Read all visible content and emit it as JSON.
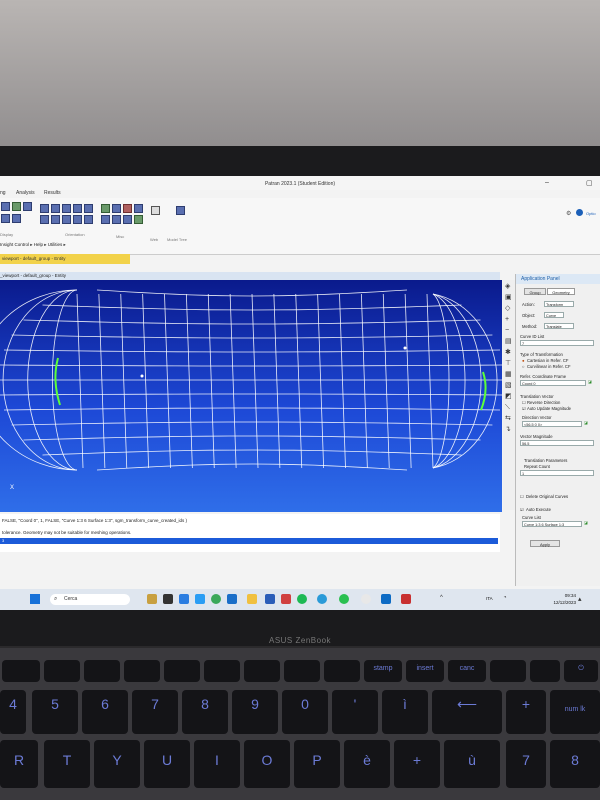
{
  "window": {
    "title": "Patran 2023.1 (Student Edition)",
    "controls": {
      "minimize": "–",
      "restore": "▢"
    }
  },
  "menu": {
    "items": [
      "ng",
      "Analysis",
      "Results"
    ]
  },
  "ribbon": {
    "group_labels": [
      "Display",
      "Orientation",
      "Misc",
      "Web",
      "Model Tree"
    ],
    "help_label": "Optio"
  },
  "breadcrumb": "Insight Control ▸ Help ▸ Utilities ▸",
  "document_tab": "viewport - default_group - Entity",
  "viewport_title": "_viewport - default_group - Entity",
  "axis_label": "X",
  "command_log": {
    "line1": "FALSE, \"Coord 0\", 1, FALSE, \"Curve 1:3 6 Surface 1:3\", sgm_transform_curve_created_ids )",
    "line2": "tolerance. Geometry may not be suitable for meshing operations.",
    "line3": "3"
  },
  "app_panel": {
    "title": "Application Panel",
    "tabs": [
      "Group",
      "Geometry"
    ],
    "action_label": "Action:",
    "action_value": "Transform",
    "object_label": "Object:",
    "object_value": "Curve",
    "method_label": "Method:",
    "method_value": "Translate",
    "curve_id_label": "Curve ID List",
    "curve_id_value": "7",
    "type_label": "Type of Transformation",
    "type_option1": "Cartesian in Refer. CF",
    "type_option2": "Curvilinear in Refer. CF",
    "refer_label": "Refer. Coordinate Frame",
    "refer_value": "Coord 0",
    "translation_label": "Translation Vector",
    "reverse_label": "Reverse Direction",
    "auto_update_label": "Auto Update Magnitude",
    "direction_label": "Direction Vector",
    "direction_value": "<56.5 0 0>",
    "magnitude_label": "Vector Magnitude",
    "magnitude_value": "56.5",
    "params_label": "Translation Parameters",
    "repeat_label": "Repeat Count",
    "repeat_value": "1",
    "delete_label": "Delete Original Curves",
    "auto_execute_label": "Auto Execute",
    "curve_list_label": "Curve List",
    "curve_list_value": "Curve 1:3 6 Surface 1:3",
    "apply_label": "Apply"
  },
  "taskbar": {
    "search_placeholder": "Cerca",
    "language": "ITA",
    "time": "09:34",
    "date": "12/12/2023"
  },
  "laptop_brand": "ASUS ZenBook",
  "keyboard": {
    "fn_row": [
      "",
      "",
      "",
      "",
      "",
      "",
      "",
      "",
      "",
      "",
      "",
      "stamp",
      "insert",
      "canc",
      "",
      "",
      ""
    ],
    "num_row": [
      "4",
      "5",
      "6",
      "7",
      "8",
      "9",
      "0",
      "'",
      "ì",
      "",
      "",
      "num lk"
    ],
    "letter_row": [
      "R",
      "T",
      "Y",
      "U",
      "I",
      "O",
      "P",
      "è",
      "+",
      "ù",
      "7",
      "8"
    ]
  },
  "colors": {
    "viewport_top": "#0a1a8c",
    "viewport_bottom": "#2f6ee9",
    "mesh": "#ffffff",
    "highlight": "#5cff3a",
    "tab_highlight": "#f2d24a"
  }
}
